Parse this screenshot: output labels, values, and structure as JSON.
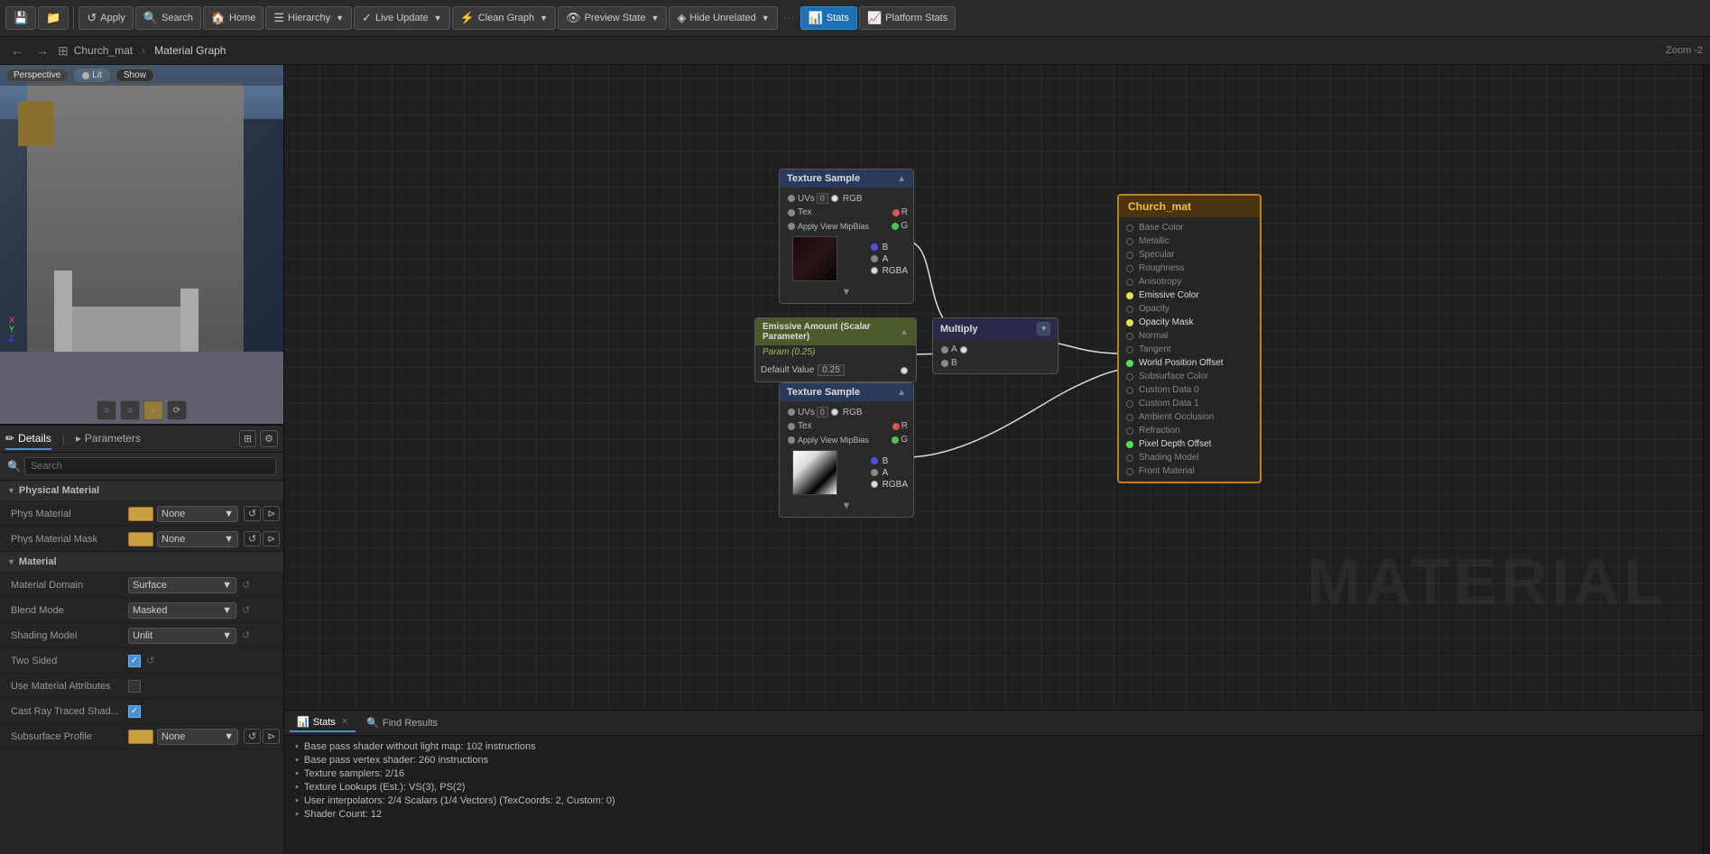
{
  "toolbar": {
    "apply_label": "Apply",
    "search_label": "Search",
    "home_label": "Home",
    "hierarchy_label": "Hierarchy",
    "live_update_label": "Live Update",
    "clean_graph_label": "Clean Graph",
    "preview_state_label": "Preview State",
    "hide_unrelated_label": "Hide Unrelated",
    "stats_label": "Stats",
    "platform_stats_label": "Platform Stats"
  },
  "viewport_bar": {
    "breadcrumb_parent": "Church_mat",
    "breadcrumb_current": "Material Graph",
    "zoom_label": "Zoom -2"
  },
  "viewport": {
    "perspective_label": "Perspective",
    "lit_label": "Lit",
    "show_label": "Show"
  },
  "details": {
    "tab_details": "Details",
    "tab_parameters": "Parameters",
    "search_placeholder": "Search",
    "sections": {
      "physical_material": "Physical Material",
      "material": "Material"
    },
    "properties": {
      "phys_material": "Phys Material",
      "phys_material_mask": "Phys Material Mask",
      "material_domain": "Material Domain",
      "material_domain_value": "Surface",
      "blend_mode": "Blend Mode",
      "blend_mode_value": "Masked",
      "shading_model": "Shading Model",
      "shading_model_value": "Unlit",
      "two_sided": "Two Sided",
      "use_material_attributes": "Use Material Attributes",
      "cast_ray_traced_shad": "Cast Ray Traced Shad...",
      "subsurface_profile": "Subsurface Profile",
      "subsurface_profile_value": "None"
    }
  },
  "nodes": {
    "texture_sample_1": {
      "title": "Texture Sample",
      "uvs_label": "UVs",
      "uvs_value": "0",
      "tex_label": "Tex",
      "apply_view_mip_bias": "Apply View MipBias",
      "rgb_label": "RGB",
      "r_label": "R",
      "g_label": "G",
      "b_label": "B",
      "a_label": "A",
      "rgba_label": "RGBA"
    },
    "emissive_amount": {
      "title": "Emissive Amount (Scalar Parameter)",
      "param_label": "Param (0.25)",
      "default_value_label": "Default Value",
      "default_value": "0.25"
    },
    "texture_sample_2": {
      "title": "Texture Sample",
      "uvs_label": "UVs",
      "uvs_value": "0",
      "tex_label": "Tex",
      "apply_view_mip_bias": "Apply View MipBias",
      "rgb_label": "RGB",
      "r_label": "R",
      "g_label": "G",
      "b_label": "B",
      "a_label": "A",
      "rgba_label": "RGBA"
    },
    "multiply": {
      "title": "Multiply",
      "a_label": "A",
      "b_label": "B"
    },
    "church_mat": {
      "title": "Church_mat",
      "pins": [
        {
          "label": "Base Color",
          "active": false
        },
        {
          "label": "Metallic",
          "active": false
        },
        {
          "label": "Specular",
          "active": false
        },
        {
          "label": "Roughness",
          "active": false
        },
        {
          "label": "Anisotropy",
          "active": false
        },
        {
          "label": "Emissive Color",
          "active": true,
          "color": "yellow"
        },
        {
          "label": "Opacity",
          "active": false
        },
        {
          "label": "Opacity Mask",
          "active": true,
          "color": "yellow"
        },
        {
          "label": "Normal",
          "active": false
        },
        {
          "label": "Tangent",
          "active": false
        },
        {
          "label": "World Position Offset",
          "active": true,
          "color": "green"
        },
        {
          "label": "Subsurface Color",
          "active": false
        },
        {
          "label": "Custom Data 0",
          "active": false
        },
        {
          "label": "Custom Data 1",
          "active": false
        },
        {
          "label": "Ambient Occlusion",
          "active": false
        },
        {
          "label": "Refraction",
          "active": false
        },
        {
          "label": "Pixel Depth Offset",
          "active": true,
          "color": "green"
        },
        {
          "label": "Shading Model",
          "active": false
        },
        {
          "label": "Front Material",
          "active": false
        }
      ]
    }
  },
  "stats": {
    "tab_label": "Stats",
    "find_results_label": "Find Results",
    "items": [
      "Base pass shader without light map: 102 instructions",
      "Base pass vertex shader: 260 instructions",
      "Texture samplers: 2/16",
      "Texture Lookups (Est.): VS(3), PS(2)",
      "User interpolators: 2/4 Scalars (1/4 Vectors) (TexCoords: 2, Custom: 0)",
      "Shader Count: 12"
    ]
  }
}
